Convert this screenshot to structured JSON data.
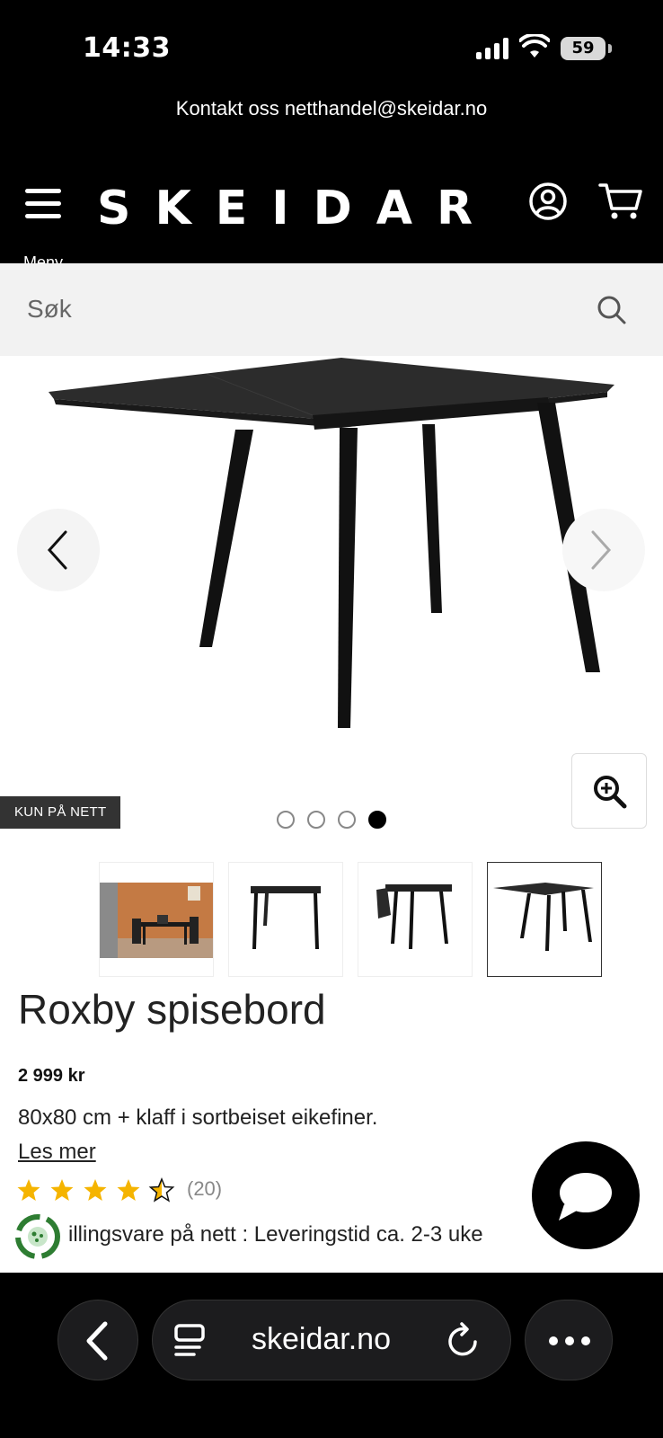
{
  "status_bar": {
    "time": "14:33",
    "battery": "59"
  },
  "top_banner": {
    "contact_text": "Kontakt oss netthandel@skeidar.no"
  },
  "header": {
    "logo": "SKEIDAR",
    "menu_label": "Meny"
  },
  "search": {
    "placeholder": "Søk"
  },
  "gallery": {
    "badge": "KUN PÅ NETT",
    "dots_count": 4,
    "active_dot": 3,
    "selected_thumb": 3
  },
  "product": {
    "title": "Roxby spisebord",
    "price": "2 999 kr",
    "description": "80x80 cm + klaff i sortbeiset eikefiner.",
    "read_more": "Les mer",
    "rating_value": 4.5,
    "rating_count": "(20)",
    "delivery_text": "illingsvare på nett : Leveringstid ca. 2-3 uke"
  },
  "browser": {
    "url": "skeidar.no"
  },
  "colors": {
    "accent_star": "#f5b400",
    "brand_black": "#000000",
    "delivery_green": "#2e7d32"
  }
}
